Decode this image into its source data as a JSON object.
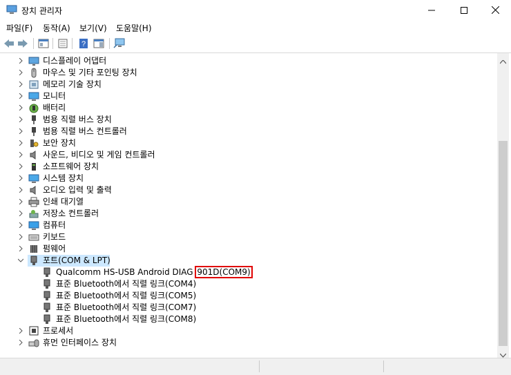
{
  "window": {
    "title": "장치 관리자",
    "controls": {
      "minimize": "—",
      "maximize": "☐",
      "close": "✕"
    }
  },
  "menu": [
    "파일(F)",
    "동작(A)",
    "보기(V)",
    "도움말(H)"
  ],
  "toolbar": [
    "back-arrow-icon",
    "forward-arrow-icon",
    "properties-icon",
    "show-hide-icon",
    "help-icon",
    "action-pane-icon",
    "monitor-scan-icon"
  ],
  "tree": {
    "categories_top": [
      {
        "label": "디스플레이 어댑터",
        "icon": "display-adapter-icon"
      },
      {
        "label": "마우스 및 기타 포인팅 장치",
        "icon": "mouse-icon"
      },
      {
        "label": "메모리 기술 장치",
        "icon": "memory-icon"
      },
      {
        "label": "모니터",
        "icon": "monitor-icon"
      },
      {
        "label": "배터리",
        "icon": "battery-icon"
      },
      {
        "label": "범용 직렬 버스 장치",
        "icon": "usb-icon"
      },
      {
        "label": "범용 직렬 버스 컨트롤러",
        "icon": "usb-icon"
      },
      {
        "label": "보안 장치",
        "icon": "security-icon"
      },
      {
        "label": "사운드, 비디오 및 게임 컨트롤러",
        "icon": "speaker-icon"
      },
      {
        "label": "소프트웨어 장치",
        "icon": "software-icon"
      },
      {
        "label": "시스템 장치",
        "icon": "system-icon"
      },
      {
        "label": "오디오 입력 및 출력",
        "icon": "speaker-icon"
      },
      {
        "label": "인쇄 대기열",
        "icon": "printer-icon"
      },
      {
        "label": "저장소 컨트롤러",
        "icon": "storage-icon"
      },
      {
        "label": "컴퓨터",
        "icon": "computer-icon"
      },
      {
        "label": "키보드",
        "icon": "keyboard-icon"
      },
      {
        "label": "펌웨어",
        "icon": "firmware-icon"
      }
    ],
    "ports": {
      "label": "포트(COM & LPT)",
      "children": [
        {
          "label": "Qualcomm HS-USB Android DIAG ",
          "highlight": "901D(COM9)"
        },
        {
          "label": "표준 Bluetooth에서 직렬 링크(COM4)"
        },
        {
          "label": "표준 Bluetooth에서 직렬 링크(COM5)"
        },
        {
          "label": "표준 Bluetooth에서 직렬 링크(COM7)"
        },
        {
          "label": "표준 Bluetooth에서 직렬 링크(COM8)"
        }
      ]
    },
    "categories_bottom": [
      {
        "label": "프로세서",
        "icon": "processor-icon"
      },
      {
        "label": "휴먼 인터페이스 장치",
        "icon": "hid-icon"
      }
    ]
  }
}
